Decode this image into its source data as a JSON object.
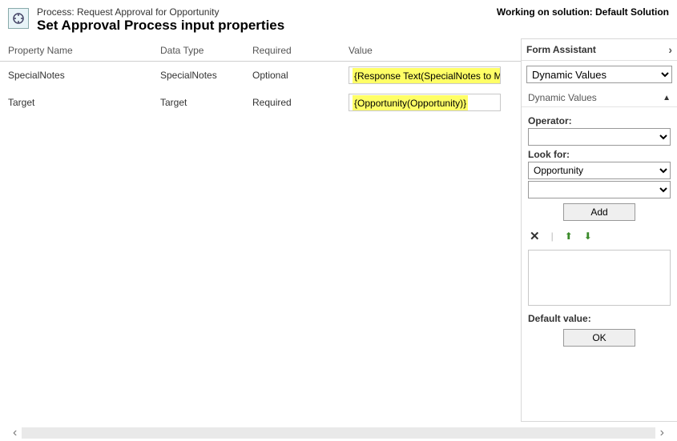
{
  "header": {
    "process_prefix": "Process: ",
    "process_name": "Request Approval for Opportunity",
    "title": "Set Approval Process input properties",
    "working_on_prefix": "Working on solution: ",
    "solution_name": "Default Solution"
  },
  "columns": {
    "name": "Property Name",
    "datatype": "Data Type",
    "required": "Required",
    "value": "Value"
  },
  "rows": [
    {
      "name": "SpecialNotes",
      "datatype": "SpecialNotes",
      "required": "Optional",
      "value": "{Response Text(SpecialNotes to Manager)}"
    },
    {
      "name": "Target",
      "datatype": "Target",
      "required": "Required",
      "value": "{Opportunity(Opportunity)}"
    }
  ],
  "form_assistant": {
    "title": "Form Assistant",
    "top_select": "Dynamic Values",
    "section_title": "Dynamic Values",
    "operator_label": "Operator:",
    "lookfor_label": "Look for:",
    "lookfor_value": "Opportunity",
    "add_label": "Add",
    "default_value_label": "Default value:",
    "ok_label": "OK"
  }
}
